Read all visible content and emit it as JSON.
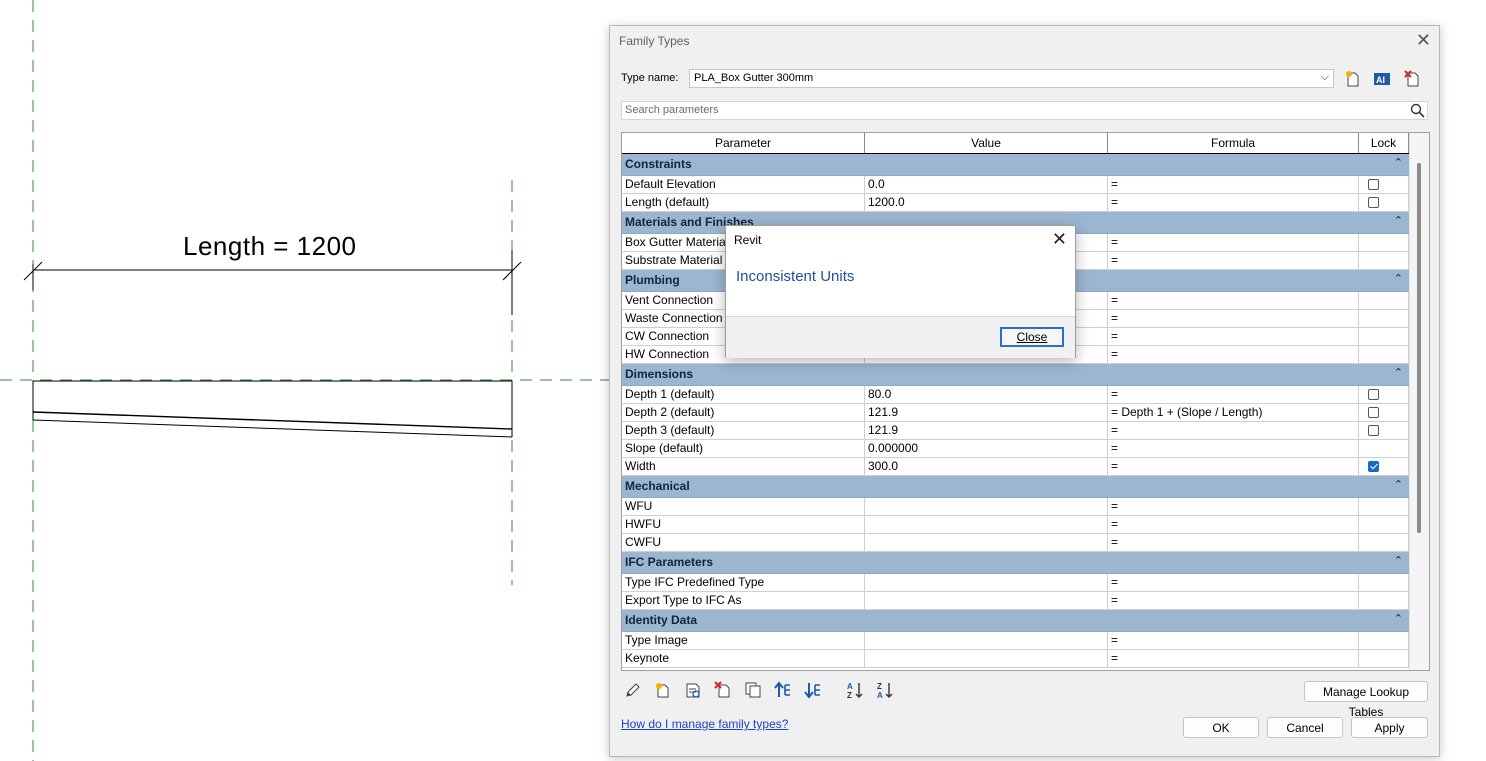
{
  "canvas": {
    "dimension_text": "Length = 1200"
  },
  "family_types": {
    "title": "Family Types",
    "type_name_label": "Type name:",
    "type_name_value": "PLA_Box Gutter 300mm",
    "search_placeholder": "Search parameters",
    "columns": [
      "Parameter",
      "Value",
      "Formula",
      "Lock"
    ],
    "groups": [
      {
        "name": "Constraints",
        "rows": [
          {
            "param": "Default Elevation",
            "value": "0.0",
            "formula": "=",
            "lock": "unchecked"
          },
          {
            "param": "Length (default)",
            "value": "1200.0",
            "formula": "=",
            "lock": "unchecked"
          }
        ]
      },
      {
        "name": "Materials and Finishes",
        "rows": [
          {
            "param": "Box Gutter Material",
            "value": "",
            "formula": "=",
            "lock": "none"
          },
          {
            "param": "Substrate Material",
            "value": "",
            "formula": "=",
            "lock": "none"
          }
        ]
      },
      {
        "name": "Plumbing",
        "rows": [
          {
            "param": "Vent Connection",
            "value": "",
            "formula": "=",
            "lock": "none"
          },
          {
            "param": "Waste Connection",
            "value": "",
            "formula": "=",
            "lock": "none"
          },
          {
            "param": "CW Connection",
            "value": "",
            "formula": "=",
            "lock": "none"
          },
          {
            "param": "HW Connection",
            "value": "",
            "formula": "=",
            "lock": "none"
          }
        ]
      },
      {
        "name": "Dimensions",
        "rows": [
          {
            "param": "Depth 1 (default)",
            "value": "80.0",
            "formula": "=",
            "lock": "unchecked"
          },
          {
            "param": "Depth 2 (default)",
            "value": "121.9",
            "formula": "= Depth 1 + (Slope / Length)",
            "lock": "unchecked"
          },
          {
            "param": "Depth 3 (default)",
            "value": "121.9",
            "formula": "=",
            "lock": "unchecked"
          },
          {
            "param": "Slope (default)",
            "value": "0.000000",
            "formula": "=",
            "lock": "none"
          },
          {
            "param": "Width",
            "value": "300.0",
            "formula": "=",
            "lock": "checked"
          }
        ]
      },
      {
        "name": "Mechanical",
        "rows": [
          {
            "param": "WFU",
            "value": "",
            "formula": "=",
            "lock": "none"
          },
          {
            "param": "HWFU",
            "value": "",
            "formula": "=",
            "lock": "none"
          },
          {
            "param": "CWFU",
            "value": "",
            "formula": "=",
            "lock": "none"
          }
        ]
      },
      {
        "name": "IFC Parameters",
        "rows": [
          {
            "param": "Type IFC Predefined Type",
            "value": "",
            "formula": "=",
            "lock": "none"
          },
          {
            "param": "Export Type to IFC As",
            "value": "",
            "formula": "=",
            "lock": "none"
          }
        ]
      },
      {
        "name": "Identity Data",
        "rows": [
          {
            "param": "Type Image",
            "value": "",
            "formula": "=",
            "lock": "none"
          },
          {
            "param": "Keynote",
            "value": "",
            "formula": "=",
            "lock": "none"
          }
        ]
      }
    ],
    "buttons": {
      "manage_lookup": "Manage Lookup Tables",
      "ok": "OK",
      "cancel": "Cancel",
      "apply": "Apply"
    },
    "help_link": "How do I manage family types?"
  },
  "revit_popup": {
    "title": "Revit",
    "message": "Inconsistent Units",
    "close_label": "Close"
  },
  "colors": {
    "group_header": "#9cb6d2",
    "link": "#1a44c9",
    "checkbox_checked": "#1769c8",
    "reference_plane": "#2e8b2e",
    "popup_message": "#1f4f9c"
  }
}
